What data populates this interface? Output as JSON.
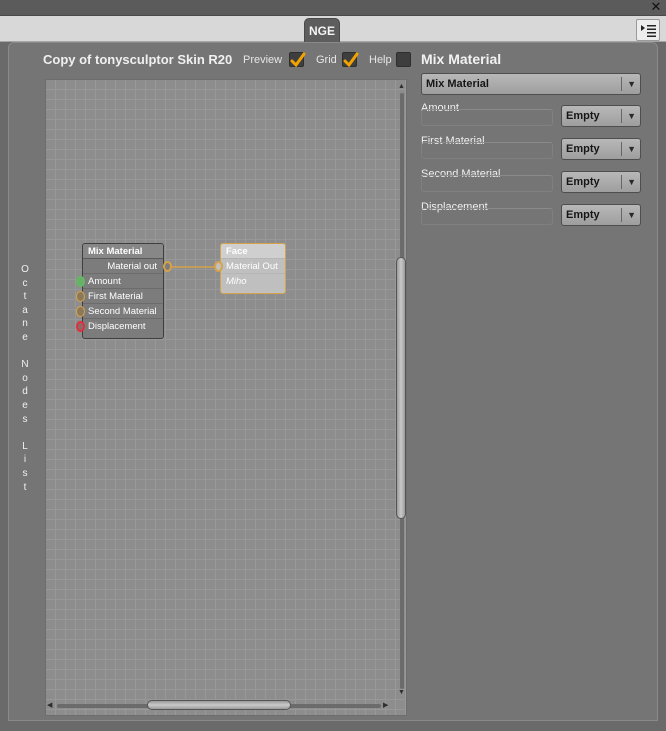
{
  "tab": {
    "label": "NGE"
  },
  "header": {
    "doc_title": "Copy of tonysculptor Skin R20",
    "preview_label": "Preview",
    "preview_checked": true,
    "grid_label": "Grid",
    "grid_checked": true,
    "help_label": "Help",
    "help_checked": false
  },
  "side_panel_label": [
    "O",
    "c",
    "t",
    "a",
    "n",
    "e",
    "",
    "N",
    "o",
    "d",
    "e",
    "s",
    "",
    "L",
    "i",
    "s",
    "t"
  ],
  "nodes": {
    "mix": {
      "title": "Mix Material",
      "output": "Material out",
      "inputs": [
        "Amount",
        "First Material",
        "Second Material",
        "Displacement"
      ]
    },
    "face": {
      "title": "Face",
      "output": "Material Out",
      "extra": "Miho"
    }
  },
  "inspector": {
    "title": "Mix Material",
    "type_select": "Mix Material",
    "params": [
      {
        "label": "Amount",
        "value": "Empty"
      },
      {
        "label": "First Material",
        "value": "Empty"
      },
      {
        "label": "Second Material",
        "value": "Empty"
      },
      {
        "label": "Displacement",
        "value": "Empty"
      }
    ]
  },
  "colors": {
    "accent_check": "#f2a300",
    "port_amount": "#5cbf5c",
    "port_material": "#d6a24a",
    "port_displacement": "#e0303a",
    "link": "#d6a24a"
  },
  "icons": [
    "close-icon",
    "panel-menu-icon",
    "checkmark-icon",
    "dropdown-caret-icon",
    "scroll-arrow-icon"
  ]
}
